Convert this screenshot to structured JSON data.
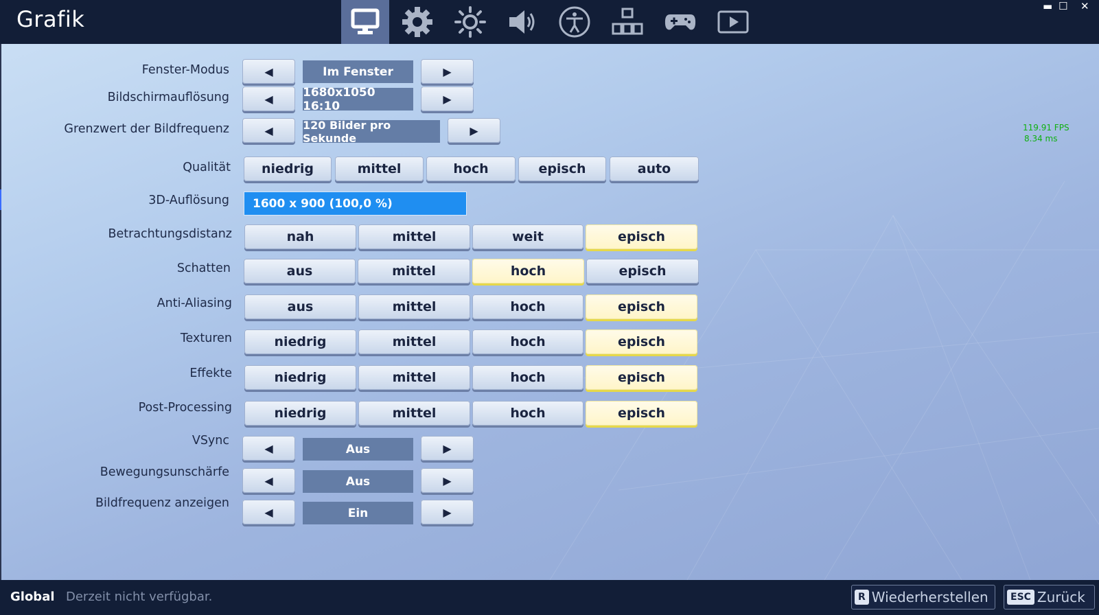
{
  "header": {
    "title": "Grafik",
    "tabs": [
      {
        "icon": "monitor-icon",
        "active": true
      },
      {
        "icon": "gear-icon",
        "active": false
      },
      {
        "icon": "brightness-icon",
        "active": false
      },
      {
        "icon": "speaker-icon",
        "active": false
      },
      {
        "icon": "accessibility-icon",
        "active": false
      },
      {
        "icon": "input-icon",
        "active": false
      },
      {
        "icon": "gamepad-icon",
        "active": false
      },
      {
        "icon": "replay-icon",
        "active": false
      }
    ],
    "window_controls": {
      "minimize": "▬",
      "maximize": "☐",
      "close": "✕"
    }
  },
  "settings": {
    "window_mode": {
      "label": "Fenster-Modus",
      "value": "Im Fenster"
    },
    "resolution": {
      "label": "Bildschirmauflösung",
      "value": "1680x1050 16:10"
    },
    "framerate_limit": {
      "label": "Grenzwert der Bildfrequenz",
      "value": "120 Bilder pro Sekunde"
    },
    "quality": {
      "label": "Qualität",
      "options": [
        "niedrig",
        "mittel",
        "hoch",
        "episch",
        "auto"
      ]
    },
    "resolution_3d": {
      "label": "3D-Auflösung",
      "value": "1600 x 900 (100,0 %)"
    },
    "view_distance": {
      "label": "Betrachtungsdistanz",
      "options": [
        "nah",
        "mittel",
        "weit",
        "episch"
      ],
      "selected": "episch"
    },
    "shadows": {
      "label": "Schatten",
      "options": [
        "aus",
        "mittel",
        "hoch",
        "episch"
      ],
      "selected": "hoch"
    },
    "anti_aliasing": {
      "label": "Anti-Aliasing",
      "options": [
        "aus",
        "mittel",
        "hoch",
        "episch"
      ],
      "selected": "episch"
    },
    "textures": {
      "label": "Texturen",
      "options": [
        "niedrig",
        "mittel",
        "hoch",
        "episch"
      ],
      "selected": "episch"
    },
    "effects": {
      "label": "Effekte",
      "options": [
        "niedrig",
        "mittel",
        "hoch",
        "episch"
      ],
      "selected": "episch"
    },
    "post_processing": {
      "label": "Post-Processing",
      "options": [
        "niedrig",
        "mittel",
        "hoch",
        "episch"
      ],
      "selected": "episch"
    },
    "vsync": {
      "label": "VSync",
      "value": "Aus"
    },
    "motion_blur": {
      "label": "Bewegungsunschärfe",
      "value": "Aus"
    },
    "show_fps": {
      "label": "Bildfrequenz anzeigen",
      "value": "Ein"
    }
  },
  "arrows": {
    "left": "◀",
    "right": "▶"
  },
  "fps_overlay": {
    "fps": "119.91 FPS",
    "ms": "8.34 ms"
  },
  "footer": {
    "scope": "Global",
    "status": "Derzeit nicht verfügbar.",
    "reset": {
      "key": "R",
      "label": "Wiederherstellen"
    },
    "back": {
      "key": "ESC",
      "label": "Zurück"
    }
  },
  "colors": {
    "accent_selected": "#fff5c8",
    "slider": "#1f8ef1",
    "value_box": "#647da6",
    "topbar": "#121e37"
  }
}
